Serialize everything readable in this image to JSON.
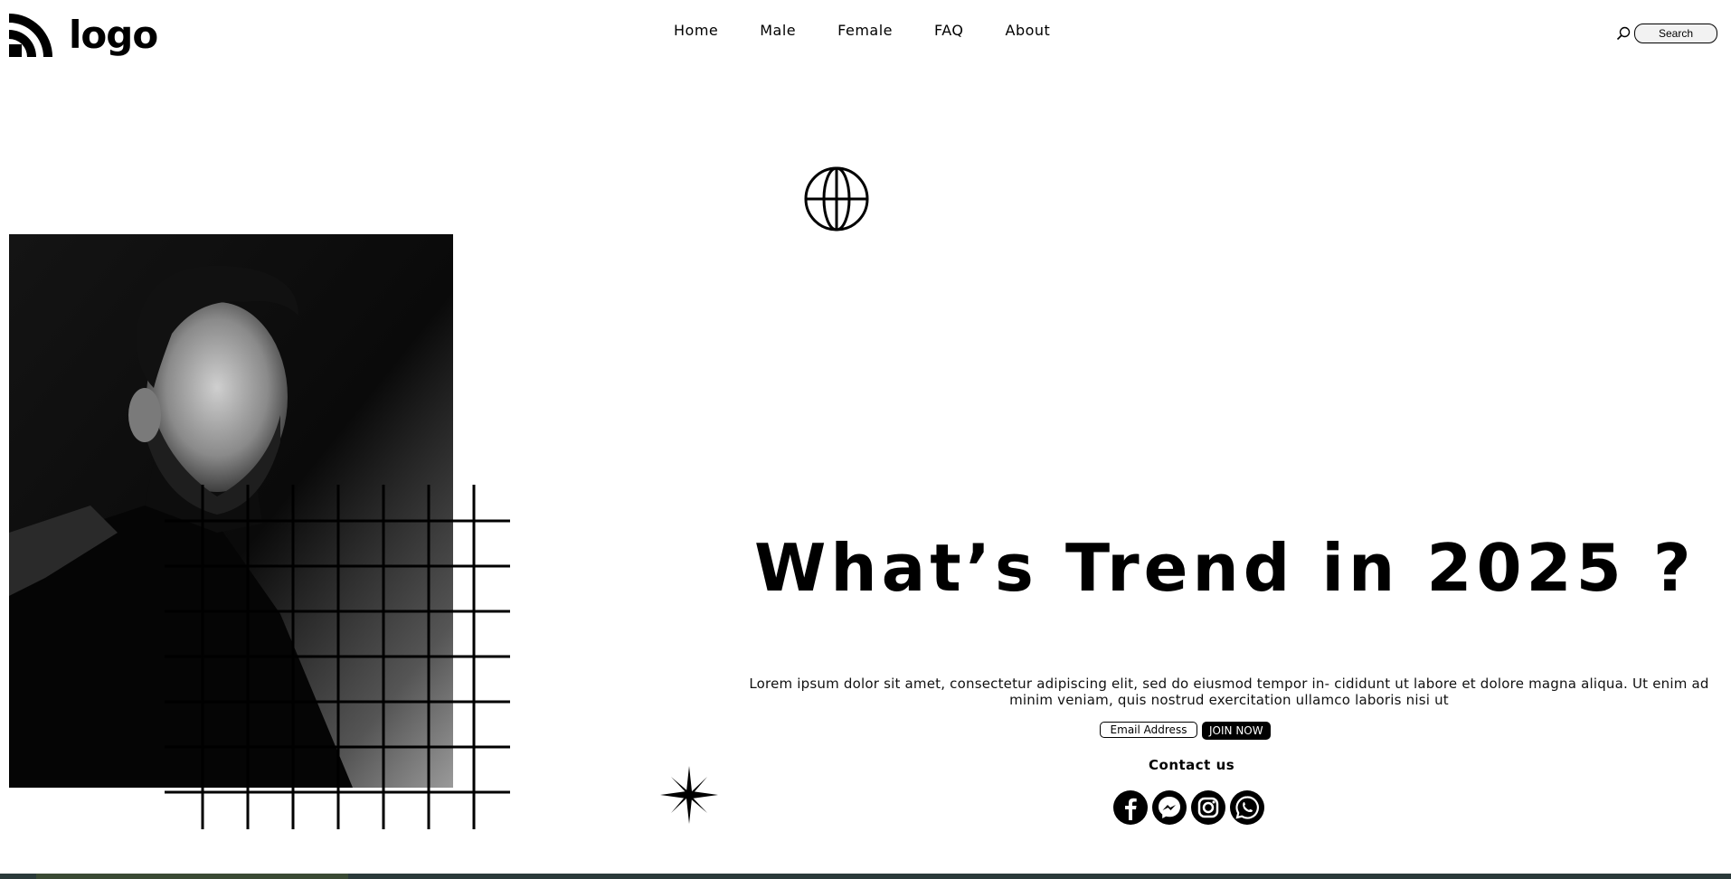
{
  "logo": {
    "text": "logo"
  },
  "nav": [
    {
      "label": "Home"
    },
    {
      "label": "Male"
    },
    {
      "label": "Female"
    },
    {
      "label": "FAQ"
    },
    {
      "label": "About"
    }
  ],
  "search": {
    "label": "Search",
    "icon": "search-icon"
  },
  "hero": {
    "headline": "What’s Trend in 2025 ?",
    "description": "Lorem ipsum dolor sit amet, consectetur adipiscing elit, sed do eiusmod tempor in- cididunt ut labore et dolore magna aliqua. Ut enim ad minim veniam, quis nostrud exercitation ullamco laboris nisi ut",
    "email_placeholder": "Email Address",
    "join_label": "JOIN NOW",
    "contact_label": "Contact us"
  },
  "socials": [
    {
      "icon": "facebook-icon"
    },
    {
      "icon": "messenger-icon"
    },
    {
      "icon": "instagram-icon"
    },
    {
      "icon": "whatsapp-icon"
    }
  ],
  "colors": {
    "primary": "#000000",
    "background": "#ffffff",
    "bottom_bar": "#2b3a3a"
  }
}
